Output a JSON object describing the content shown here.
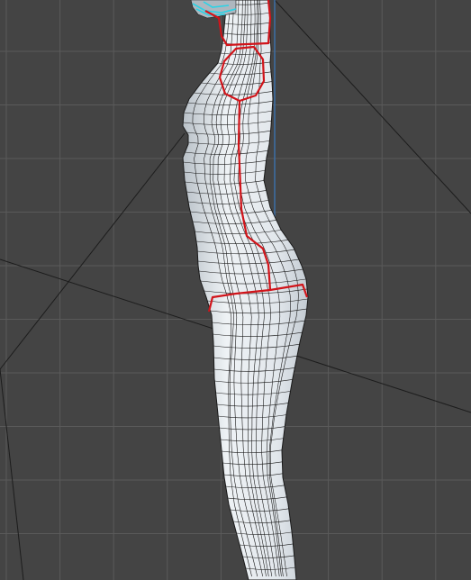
{
  "viewport": {
    "view": "side",
    "mode": "wireframe-on-shaded",
    "grid": true
  },
  "colors": {
    "background": "#444444",
    "grid_line": "#5a5a5a",
    "camera_guide": "#1c1c1c",
    "axis_line": "#3d6ea6",
    "mesh_fill": "#e4e9ee",
    "mesh_shadow": "#aeb7bf",
    "mesh_wire": "#1a1a1a",
    "seam": "#d1141a",
    "selected_edge": "#2ad3e6"
  },
  "scene": {
    "object": "female-body-mesh",
    "seams": [
      "armhole",
      "center-back",
      "waist"
    ]
  }
}
